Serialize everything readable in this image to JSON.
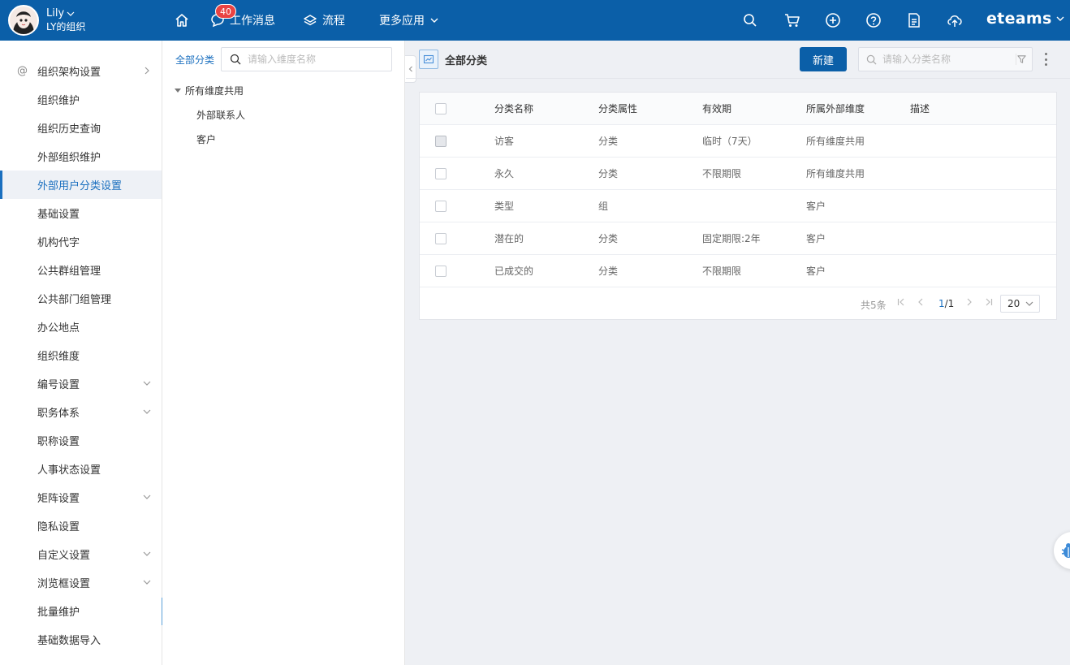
{
  "topbar": {
    "user_name": "Lily",
    "user_org": "LY的组织",
    "nav": {
      "home_icon": "home-icon",
      "messages_label": "工作消息",
      "messages_badge": "40",
      "workflow_label": "流程",
      "more_apps_label": "更多应用"
    },
    "icons": [
      "search-icon",
      "cart-icon",
      "plus-circle-icon",
      "help-icon",
      "report-icon",
      "cloud-upload-icon"
    ],
    "brand": "eteams",
    "color": "#0b5fa8"
  },
  "sidebar": {
    "items": [
      {
        "label": "组织架构设置"
      },
      {
        "label": "组织维护"
      },
      {
        "label": "组织历史查询"
      },
      {
        "label": "外部组织维护"
      },
      {
        "label": "外部用户分类设置"
      },
      {
        "label": "基础设置"
      },
      {
        "label": "机构代字"
      },
      {
        "label": "公共群组管理"
      },
      {
        "label": "公共部门组管理"
      },
      {
        "label": "办公地点"
      },
      {
        "label": "组织维度"
      },
      {
        "label": "编号设置"
      },
      {
        "label": "职务体系"
      },
      {
        "label": "职称设置"
      },
      {
        "label": "人事状态设置"
      },
      {
        "label": "矩阵设置"
      },
      {
        "label": "隐私设置"
      },
      {
        "label": "自定义设置"
      },
      {
        "label": "浏览框设置"
      },
      {
        "label": "批量维护"
      },
      {
        "label": "基础数据导入"
      }
    ],
    "active_index": 4,
    "accent_color": "#1a6fbf"
  },
  "tree": {
    "title": "全部分类",
    "search_placeholder": "请输入维度名称",
    "root": "所有维度共用",
    "children": [
      "外部联系人",
      "客户"
    ]
  },
  "content": {
    "title": "全部分类",
    "new_button": "新建",
    "search_placeholder": "请输入分类名称",
    "table": {
      "headers": [
        "分类名称",
        "分类属性",
        "有效期",
        "所属外部维度",
        "描述"
      ],
      "rows": [
        [
          "访客",
          "分类",
          "临时（7天）",
          "所有维度共用",
          ""
        ],
        [
          "永久",
          "分类",
          "不限期限",
          "所有维度共用",
          ""
        ],
        [
          "类型",
          "组",
          "",
          "客户",
          ""
        ],
        [
          "潜在的",
          "分类",
          "固定期限:2年",
          "客户",
          ""
        ],
        [
          "已成交的",
          "分类",
          "不限期限",
          "客户",
          ""
        ]
      ]
    },
    "pager": {
      "total": "共5条",
      "current": "1",
      "pages": "/1",
      "page_size": "20"
    }
  }
}
